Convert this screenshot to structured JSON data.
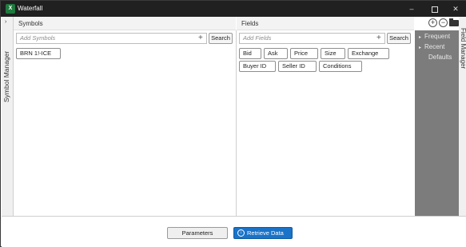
{
  "window": {
    "title": "Waterfall",
    "app_icon_letter": "X",
    "controls": {
      "minimize": "–",
      "close": "✕"
    }
  },
  "left_rail": {
    "arrow": "›",
    "label": "Symbol Manager"
  },
  "symbols": {
    "header": "Symbols",
    "input_placeholder": "Add Symbols",
    "add_glyph": "+",
    "search_label": "Search",
    "items": [
      "BRN 1!-ICE"
    ]
  },
  "fields": {
    "header": "Fields",
    "input_placeholder": "Add Fields",
    "add_glyph": "+",
    "search_label": "Search",
    "row1": [
      "Bid",
      "Ask",
      "Price",
      "Size",
      "Exchange"
    ],
    "row2": [
      "Buyer ID",
      "Seller ID",
      "Conditions"
    ]
  },
  "header_icons": {
    "add": "+",
    "remove": "−"
  },
  "field_manager": {
    "label": "Field Manager",
    "items": [
      "Frequent",
      "Recent",
      "Defaults"
    ],
    "bullet": "▸"
  },
  "footer": {
    "parameters_label": "Parameters",
    "retrieve_label": "Retrieve Data",
    "retrieve_icon": "↓"
  },
  "colors": {
    "accent": "#1a73c8",
    "titlebar": "#202020",
    "manager_panel": "#7c7c7c",
    "excel_green": "#1f7a3e"
  }
}
